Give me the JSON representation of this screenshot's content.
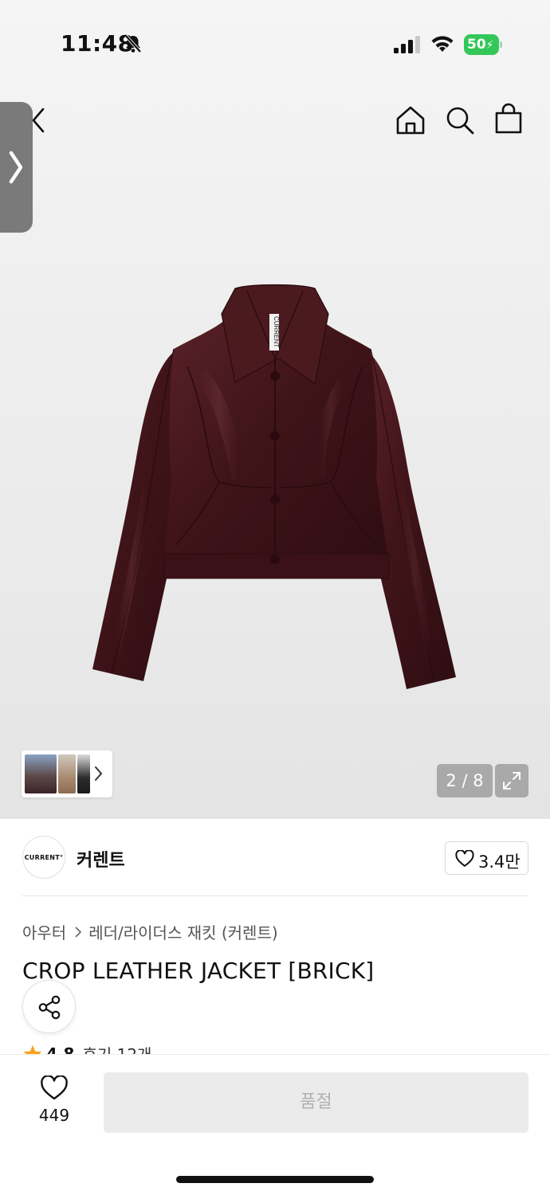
{
  "status_bar": {
    "time": "11:48",
    "battery": "50"
  },
  "nav": {
    "back_icon": "chevron-left-icon",
    "home_icon": "home-icon",
    "search_icon": "search-icon",
    "cart_icon": "shopping-bag-icon"
  },
  "gallery": {
    "counter": "2 / 8",
    "expand_icon": "expand-icon"
  },
  "brand": {
    "logo_text": "CURRENT°",
    "name": "커렌트",
    "likes": "3.4만"
  },
  "breadcrumb": {
    "category": "아우터",
    "subcategory": "레더/라이더스 재킷 (커렌트)"
  },
  "product": {
    "title": "CROP LEATHER JACKET [BRICK]",
    "label_tag": "CURRENT"
  },
  "rating": {
    "score": "4.8",
    "reviews": "후기 12개"
  },
  "bottom_bar": {
    "wish_count": "449",
    "buy_button": "품절"
  },
  "colors": {
    "accent_green": "#33c759",
    "jacket": "#4a1a1f",
    "soldout_bg": "#ebebeb",
    "star": "#f7a21b"
  }
}
